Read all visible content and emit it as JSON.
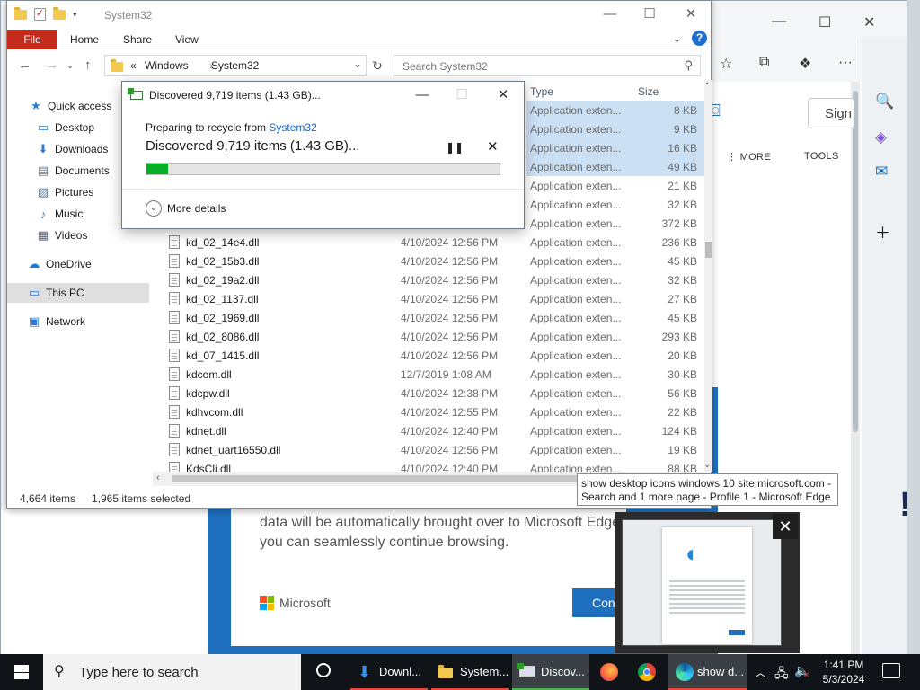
{
  "explorer": {
    "title": "System32",
    "ribbon": {
      "file": "File",
      "home": "Home",
      "share": "Share",
      "view": "View",
      "help": "?"
    },
    "address": {
      "sep": "«",
      "crumb1": "Windows",
      "crumb2": "System32"
    },
    "search_placeholder": "Search System32",
    "nav": [
      {
        "label": "Quick access",
        "icon": "star-icon"
      },
      {
        "label": "Desktop",
        "icon": "desktop-icon"
      },
      {
        "label": "Downloads",
        "icon": "download-icon"
      },
      {
        "label": "Documents",
        "icon": "document-icon"
      },
      {
        "label": "Pictures",
        "icon": "picture-icon"
      },
      {
        "label": "Music",
        "icon": "music-icon"
      },
      {
        "label": "Videos",
        "icon": "video-icon"
      },
      {
        "label": "OneDrive",
        "icon": "cloud-icon"
      },
      {
        "label": "This PC",
        "icon": "pc-icon"
      },
      {
        "label": "Network",
        "icon": "network-icon"
      }
    ],
    "columns": {
      "type": "Type",
      "size": "Size"
    },
    "rows": [
      {
        "name": "",
        "date": "",
        "type": "Application exten...",
        "size": "8 KB",
        "selected": true
      },
      {
        "name": "",
        "date": "",
        "type": "Application exten...",
        "size": "9 KB",
        "selected": true
      },
      {
        "name": "",
        "date": "",
        "type": "Application exten...",
        "size": "16 KB",
        "selected": true
      },
      {
        "name": "",
        "date": "",
        "type": "Application exten...",
        "size": "49 KB",
        "selected": true
      },
      {
        "name": "",
        "date": "",
        "type": "Application exten...",
        "size": "21 KB",
        "selected": false
      },
      {
        "name": "",
        "date": "",
        "type": "Application exten...",
        "size": "32 KB",
        "selected": false
      },
      {
        "name": "",
        "date": "",
        "type": "Application exten...",
        "size": "372 KB",
        "selected": false
      },
      {
        "name": "kd_02_14e4.dll",
        "date": "4/10/2024 12:56 PM",
        "type": "Application exten...",
        "size": "236 KB",
        "selected": false
      },
      {
        "name": "kd_02_15b3.dll",
        "date": "4/10/2024 12:56 PM",
        "type": "Application exten...",
        "size": "45 KB",
        "selected": false
      },
      {
        "name": "kd_02_19a2.dll",
        "date": "4/10/2024 12:56 PM",
        "type": "Application exten...",
        "size": "32 KB",
        "selected": false
      },
      {
        "name": "kd_02_1137.dll",
        "date": "4/10/2024 12:56 PM",
        "type": "Application exten...",
        "size": "27 KB",
        "selected": false
      },
      {
        "name": "kd_02_1969.dll",
        "date": "4/10/2024 12:56 PM",
        "type": "Application exten...",
        "size": "45 KB",
        "selected": false
      },
      {
        "name": "kd_02_8086.dll",
        "date": "4/10/2024 12:56 PM",
        "type": "Application exten...",
        "size": "293 KB",
        "selected": false
      },
      {
        "name": "kd_07_1415.dll",
        "date": "4/10/2024 12:56 PM",
        "type": "Application exten...",
        "size": "20 KB",
        "selected": false
      },
      {
        "name": "kdcom.dll",
        "date": "12/7/2019 1:08 AM",
        "type": "Application exten...",
        "size": "30 KB",
        "selected": false
      },
      {
        "name": "kdcpw.dll",
        "date": "4/10/2024 12:38 PM",
        "type": "Application exten...",
        "size": "56 KB",
        "selected": false
      },
      {
        "name": "kdhvcom.dll",
        "date": "4/10/2024 12:55 PM",
        "type": "Application exten...",
        "size": "22 KB",
        "selected": false
      },
      {
        "name": "kdnet.dll",
        "date": "4/10/2024 12:40 PM",
        "type": "Application exten...",
        "size": "124 KB",
        "selected": false
      },
      {
        "name": "kdnet_uart16550.dll",
        "date": "4/10/2024 12:56 PM",
        "type": "Application exten...",
        "size": "19 KB",
        "selected": false
      },
      {
        "name": "KdsCli.dll",
        "date": "4/10/2024 12:40 PM",
        "type": "Application exten...",
        "size": "88 KB",
        "selected": false
      }
    ],
    "status": {
      "items": "4,664 items",
      "selected": "1,965 items selected"
    }
  },
  "dialog": {
    "title": "Discovered 9,719 items (1.43 GB)...",
    "prep_prefix": "Preparing to recycle from ",
    "prep_link": "System32",
    "headline": "Discovered 9,719 items (1.43 GB)...",
    "progress": 0.06,
    "more_details": "More details"
  },
  "edge": {
    "sign": "Sign",
    "more": "⋮ MORE",
    "tools": "TOOLS",
    "body_text": "data will be automatically brought over to Microsoft Edge you can seamlessly continue browsing.",
    "brand": "Microsoft",
    "cont": "Cont"
  },
  "tooltip": "show desktop icons windows 10 site:microsoft.com - Search and 1 more page - Profile 1 - Microsoft Edge",
  "taskbar": {
    "search_placeholder": "Type here to search",
    "apps": [
      {
        "label": "Downl...",
        "color": "#e8453c"
      },
      {
        "label": "System...",
        "color": "#e8453c"
      },
      {
        "label": "Discov...",
        "color": "#4caf50"
      },
      {
        "label": "show d...",
        "color": "#e8453c"
      }
    ],
    "time": "1:41 PM",
    "date": "5/3/2024"
  },
  "colors": {
    "accent": "#1f6fbf",
    "file_tab": "#c42b1c",
    "progress": "#06b025",
    "selection": "#cce0f4"
  }
}
